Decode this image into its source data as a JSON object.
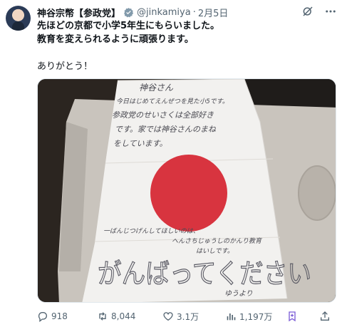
{
  "author": {
    "display_name": "神谷宗幣【参政党】",
    "handle": "@jinkamiya",
    "separator": "·",
    "date": "2月5日"
  },
  "tweet": {
    "line1": "先ほどの京都で小学5年生にもらいました。",
    "line2": "教育を変えられるように頑張ります。",
    "line3": "ありがとう！"
  },
  "media": {
    "letter_lines": [
      "神谷さん",
      "今日はじめてえんぜつを見た小5です。",
      "参政党のせいさくは全部好き",
      "です。家では神谷さんのまね",
      "をしています。"
    ],
    "letter_bottom": [
      "一ばんじつげんしてほしいのは、",
      "へんさちじゅうしのかんり教育",
      "はいしです。"
    ],
    "big_text": "がんばってください",
    "signature": "ゆうより",
    "circle_color": "#d8343f"
  },
  "actions": {
    "reply_count": "918",
    "retweet_count": "8,044",
    "like_count": "3.1万",
    "view_count": "1,197万"
  },
  "colors": {
    "muted": "#536471",
    "accent_blue": "#1d9bf0",
    "grok_purple": "#7b5cd6"
  }
}
